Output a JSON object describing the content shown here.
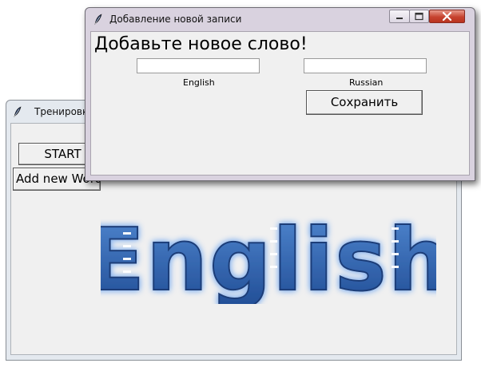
{
  "back_window": {
    "title": "Тренировка",
    "start_label": "START",
    "add_word_label": "Add new Word",
    "logo": {
      "text": "English",
      "fill": "#2e5fa8",
      "glow": "#8fb8f0"
    }
  },
  "dialog": {
    "title": "Добавление новой записи",
    "heading": "Добавьте новое слово!",
    "english_input": {
      "value": "",
      "label": "English"
    },
    "russian_input": {
      "value": "",
      "label": "Russian"
    },
    "save_label": "Сохранить"
  },
  "icons": {
    "app_icon": "feather-icon",
    "minimize": "minimize-icon",
    "maximize": "maximize-icon",
    "close": "close-icon"
  },
  "colors": {
    "close_button": "#c7432f",
    "client_bg": "#f0f0f0"
  }
}
